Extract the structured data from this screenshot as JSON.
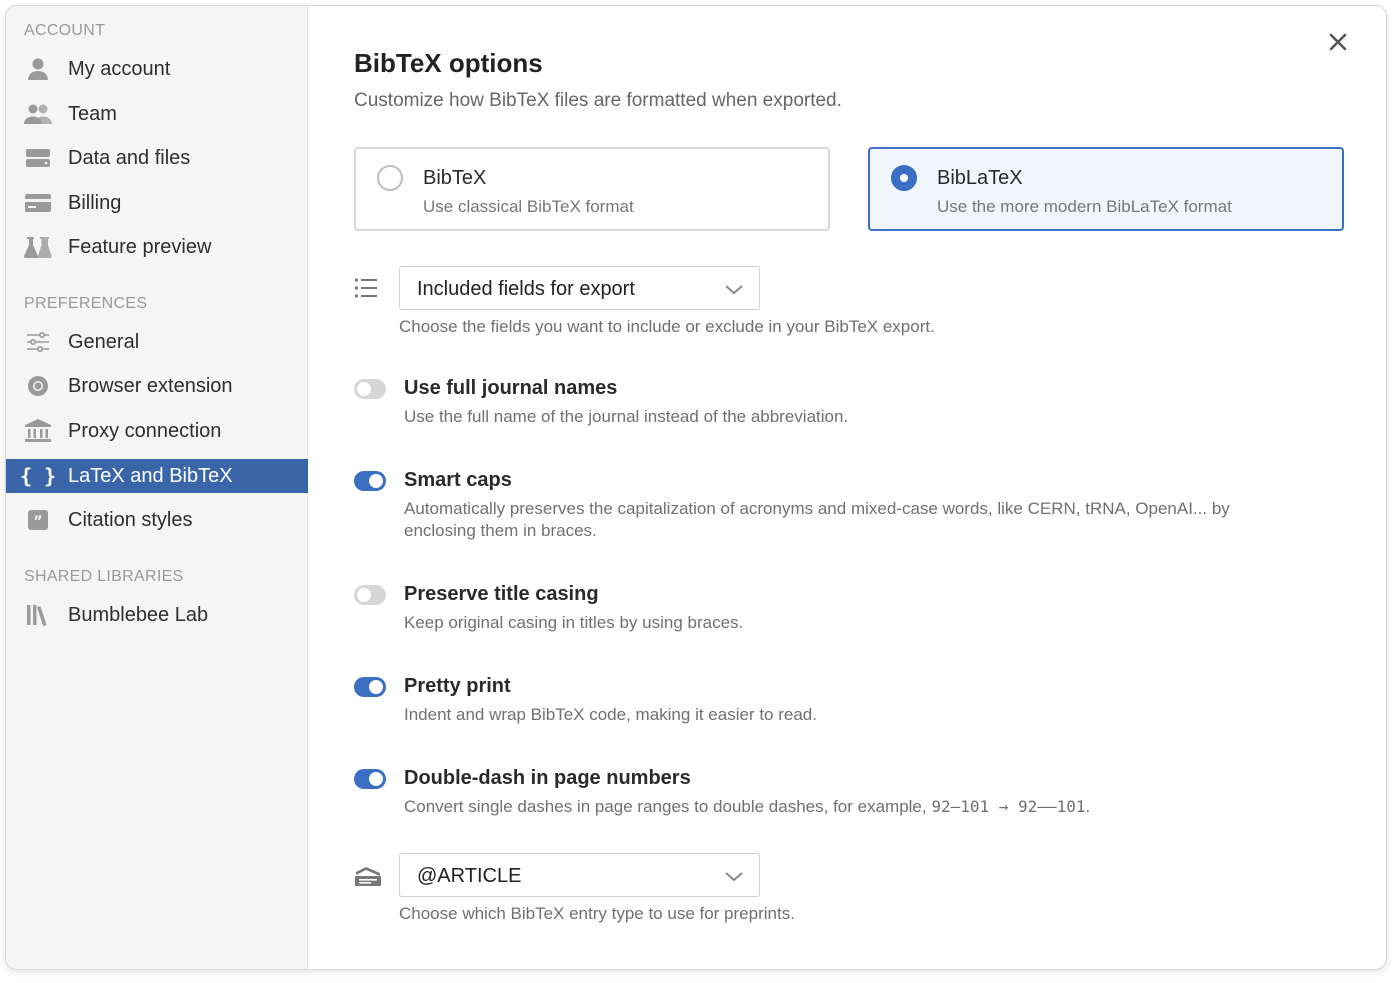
{
  "sidebar": {
    "sections": {
      "account": "ACCOUNT",
      "preferences": "PREFERENCES",
      "shared": "SHARED LIBRARIES"
    },
    "items": [
      {
        "label": "My account",
        "icon": "person-icon"
      },
      {
        "label": "Team",
        "icon": "team-icon"
      },
      {
        "label": "Data and files",
        "icon": "storage-icon"
      },
      {
        "label": "Billing",
        "icon": "credit-card-icon"
      },
      {
        "label": "Feature preview",
        "icon": "flask-icon"
      },
      {
        "label": "General",
        "icon": "sliders-icon"
      },
      {
        "label": "Browser extension",
        "icon": "chrome-icon"
      },
      {
        "label": "Proxy connection",
        "icon": "institution-icon"
      },
      {
        "label": "LaTeX and BibTeX",
        "icon": "braces-icon",
        "active": true
      },
      {
        "label": "Citation styles",
        "icon": "quote-icon"
      },
      {
        "label": "Bumblebee Lab",
        "icon": "books-icon"
      }
    ]
  },
  "main": {
    "title": "BibTeX options",
    "subtitle": "Customize how BibTeX files are formatted when exported.",
    "formats": [
      {
        "title": "BibTeX",
        "desc": "Use classical BibTeX format",
        "selected": false
      },
      {
        "title": "BibLaTeX",
        "desc": "Use the more modern BibLaTeX format",
        "selected": true
      }
    ],
    "fields_select": {
      "value": "Included fields for export",
      "help": "Choose the fields you want to include or exclude in your BibTeX export."
    },
    "options": [
      {
        "title": "Use full journal names",
        "desc": "Use the full name of the journal instead of the abbreviation.",
        "on": false
      },
      {
        "title": "Smart caps",
        "desc": "Automatically preserves the capitalization of acronyms and mixed-case words, like CERN, tRNA, OpenAI... by enclosing them in braces.",
        "on": true
      },
      {
        "title": "Preserve title casing",
        "desc": "Keep original casing in titles by using braces.",
        "on": false
      },
      {
        "title": "Pretty print",
        "desc": "Indent and wrap BibTeX code, making it easier to read.",
        "on": true
      },
      {
        "title": "Double-dash in page numbers",
        "desc_prefix": "Convert single dashes in page ranges to double dashes, for example, ",
        "desc_code": "92–101 → 92––101",
        "desc_suffix": ".",
        "on": true
      }
    ],
    "entry_select": {
      "value": "@ARTICLE",
      "help": "Choose which BibTeX entry type to use for preprints."
    }
  },
  "colors": {
    "accent": "#3a6fc4",
    "active_nav": "#3a65a8",
    "sidebar_bg": "#f5f5f5"
  }
}
